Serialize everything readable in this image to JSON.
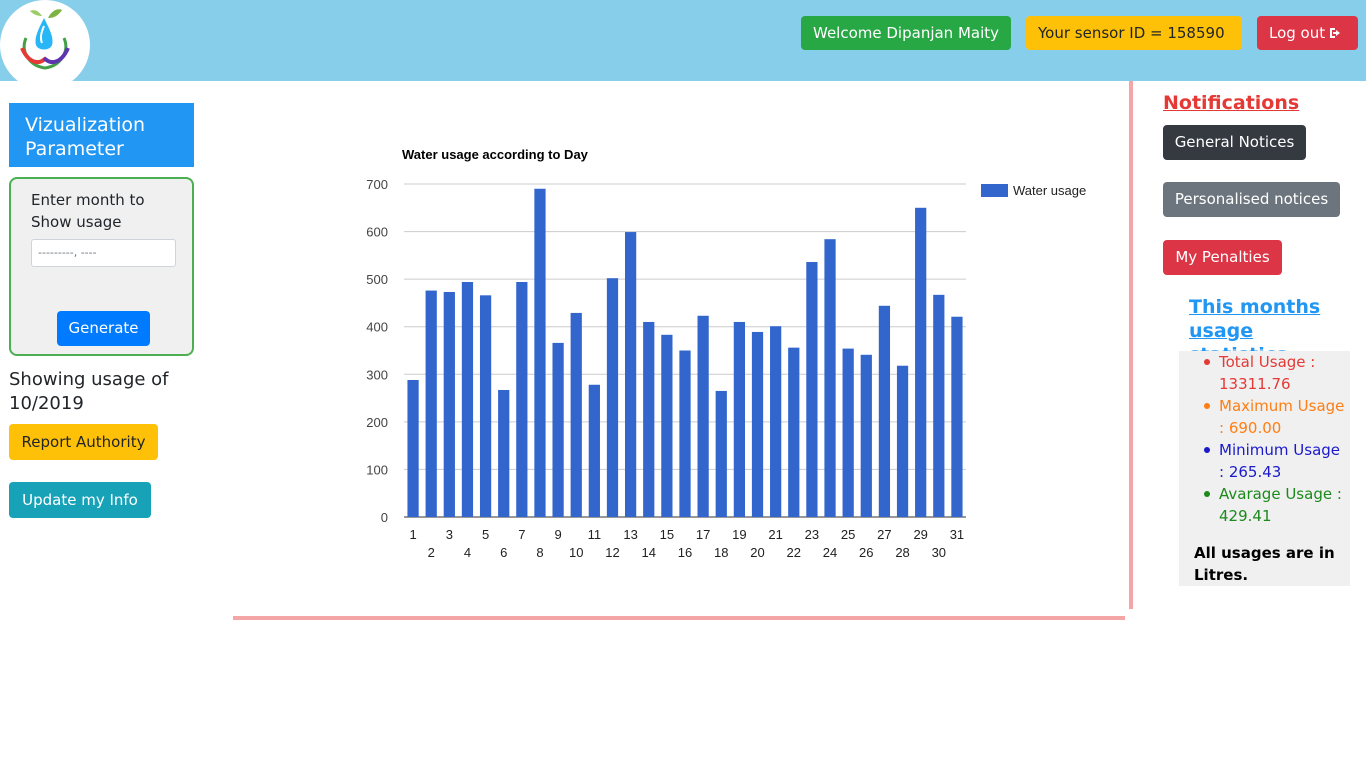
{
  "header": {
    "welcome": "Welcome Dipanjan Maity",
    "sensor": "Your sensor ID = 158590",
    "logout": "Log out"
  },
  "sidebar": {
    "title": "Vizualization Parameter",
    "month_label": "Enter month to Show usage",
    "month_placeholder": "---------, ----",
    "generate": "Generate",
    "showing": "Showing usage of 10/2019",
    "report": "Report Authority",
    "update": "Update my Info"
  },
  "notifications": {
    "title": "Notifications",
    "general": "General Notices",
    "personal": "Personalised notices",
    "penalties": "My Penalties"
  },
  "stats": {
    "title": "This months usage statistics",
    "items": [
      {
        "text": "Total Usage : 13311.76",
        "color": "#e53935"
      },
      {
        "text": "Maximum Usage : 690.00",
        "color": "#fd7e14"
      },
      {
        "text": "Minimum Usage : 265.43",
        "color": "#1a1acc"
      },
      {
        "text": "Avarage Usage : 429.41",
        "color": "#1b8a1b"
      }
    ],
    "note": "All usages are in Litres."
  },
  "chart_data": {
    "type": "bar",
    "title": "Water usage according to Day",
    "xlabel": "",
    "ylabel": "",
    "ylim": [
      0,
      700
    ],
    "yticks": [
      0,
      100,
      200,
      300,
      400,
      500,
      600,
      700
    ],
    "grid": true,
    "legend_position": "right",
    "bar_color": "#3366cc",
    "categories": [
      "1",
      "2",
      "3",
      "4",
      "5",
      "6",
      "7",
      "8",
      "9",
      "10",
      "11",
      "12",
      "13",
      "14",
      "15",
      "16",
      "17",
      "18",
      "19",
      "20",
      "21",
      "22",
      "23",
      "24",
      "25",
      "26",
      "27",
      "28",
      "29",
      "30",
      "31"
    ],
    "series": [
      {
        "name": "Water usage",
        "values": [
          288,
          476,
          473,
          494,
          466,
          267,
          494,
          690,
          366,
          429,
          278,
          502,
          599,
          410,
          383,
          350,
          423,
          265,
          410,
          389,
          401,
          356,
          536,
          584,
          354,
          341,
          444,
          318,
          650,
          467,
          421
        ]
      }
    ]
  }
}
